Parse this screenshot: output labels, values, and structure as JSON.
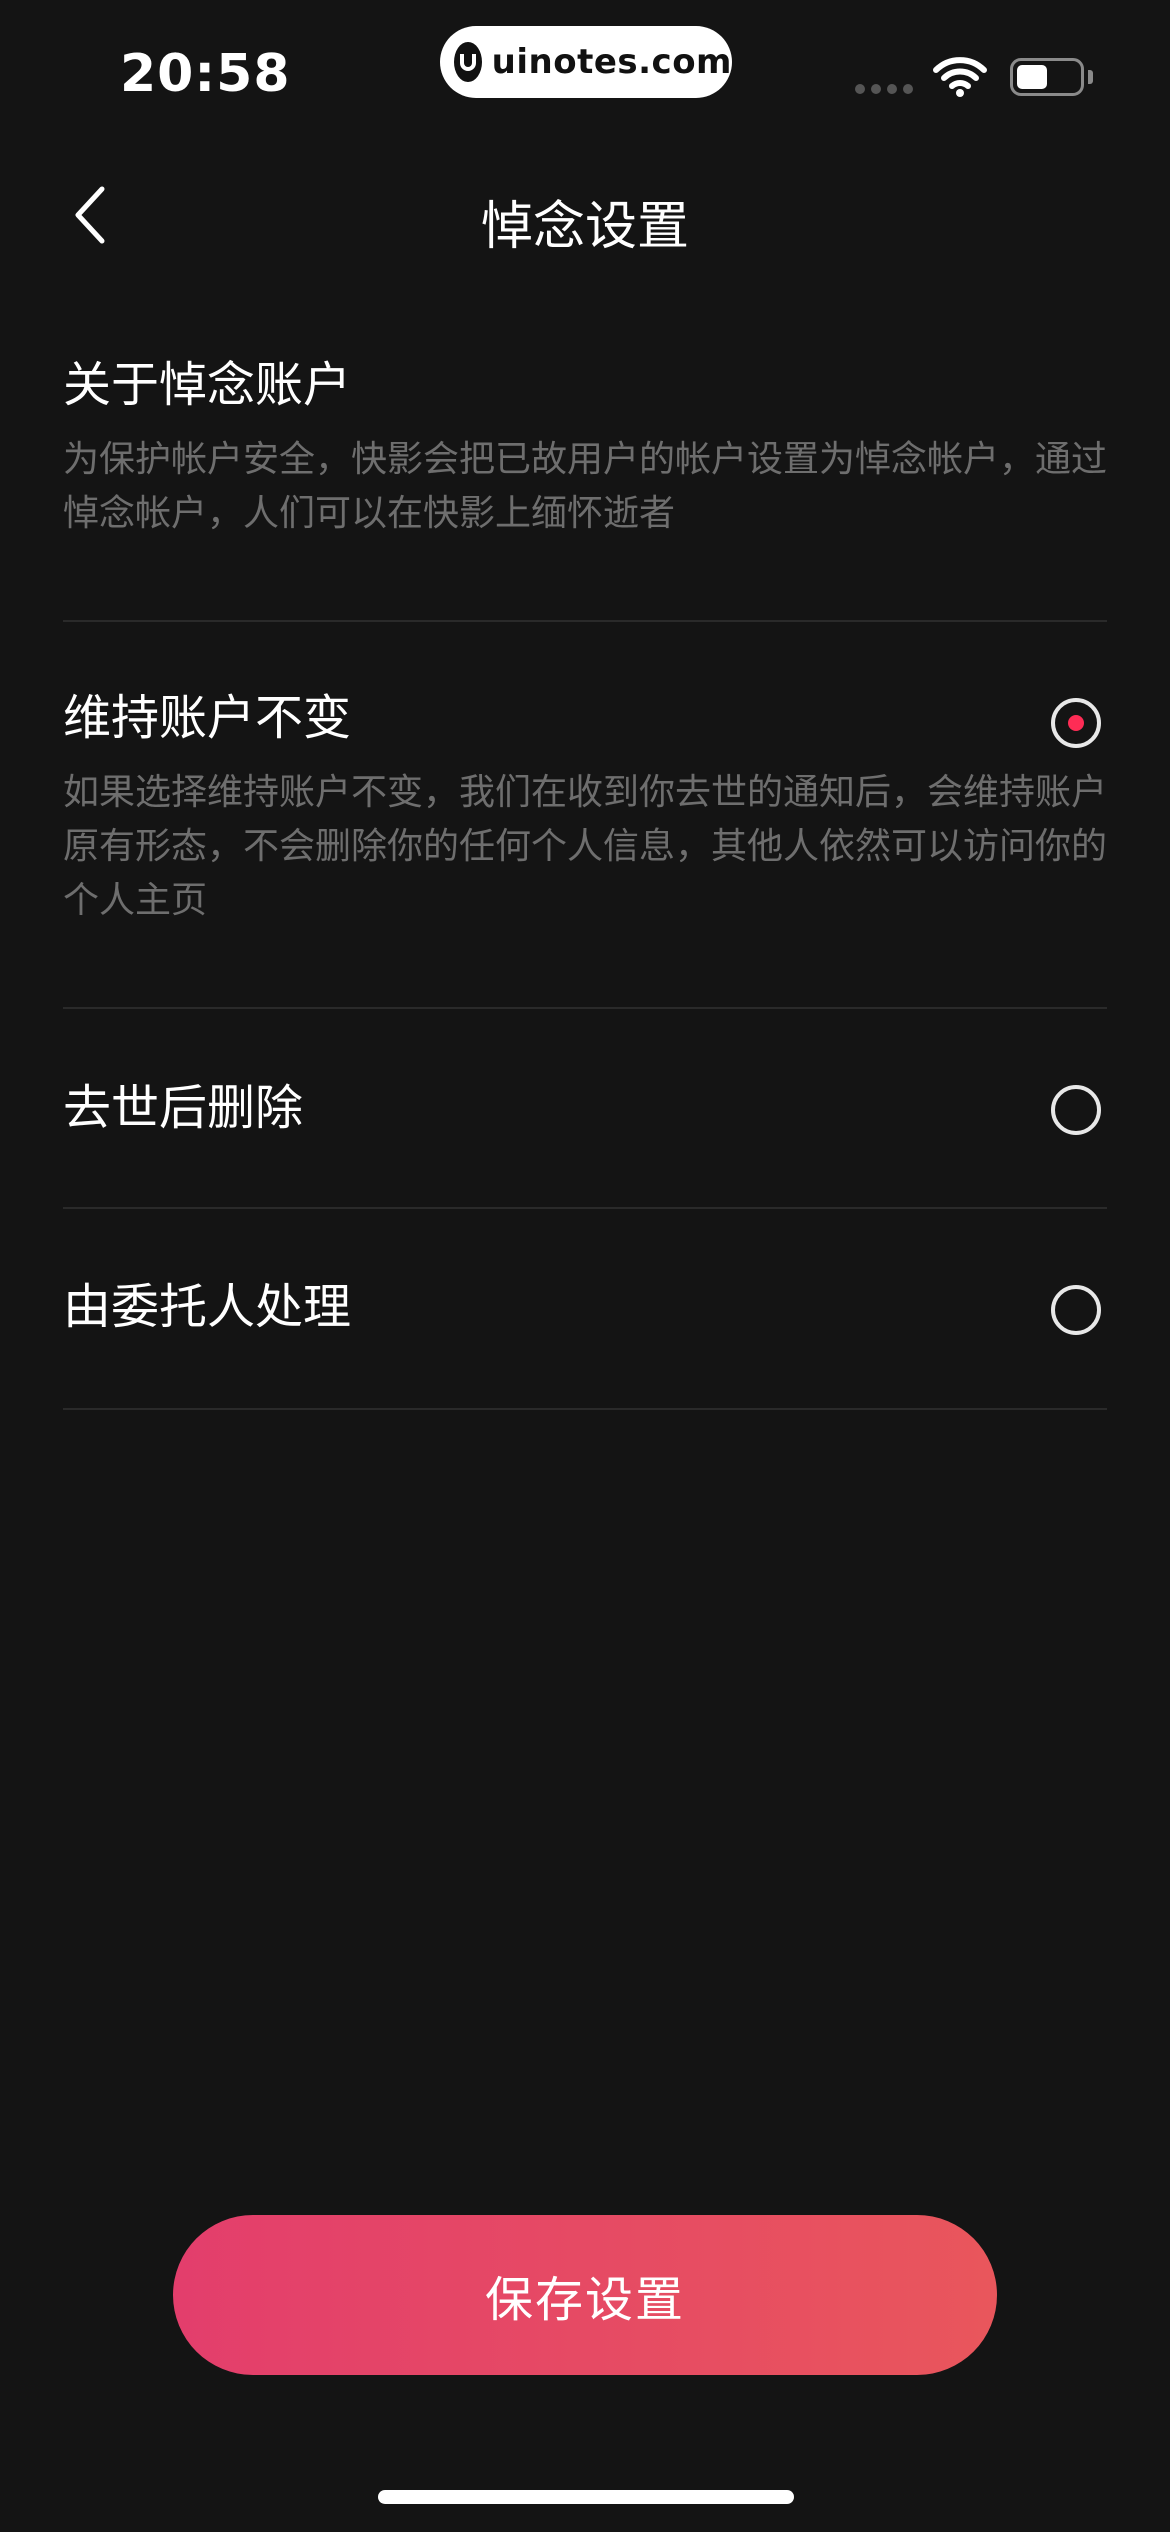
{
  "status_bar": {
    "time": "20:58",
    "watermark": "uinotes.com",
    "watermark_logo": "U",
    "icons": [
      "signal-dots-icon",
      "wifi-icon",
      "battery-icon"
    ]
  },
  "nav": {
    "title": "悼念设置",
    "back_icon": "chevron-left-icon"
  },
  "about": {
    "title": "关于悼念账户",
    "desc_line1": "为保护帐户安全，快影会把已故用户的帐户设置为悼念帐户，通过",
    "desc_line2": "悼念帐户，人们可以在快影上缅怀逝者"
  },
  "options": [
    {
      "title": "维持账户不变",
      "desc_line1": "如果选择维持账户不变，我们在收到你去世的通知后，会维持账户",
      "desc_line2": "原有形态，不会删除你的任何个人信息，其他人依然可以访问你的",
      "desc_line3": "个人主页",
      "selected": true
    },
    {
      "title": "去世后删除",
      "selected": false
    },
    {
      "title": "由委托人处理",
      "selected": false
    }
  ],
  "save_button": {
    "label": "保存设置"
  },
  "colors": {
    "background": "#141414",
    "accent": "#fe2c55",
    "button_gradient_start": "#e33e6c",
    "button_gradient_end": "#e9565c",
    "secondary_text": "#6e6e6e"
  }
}
